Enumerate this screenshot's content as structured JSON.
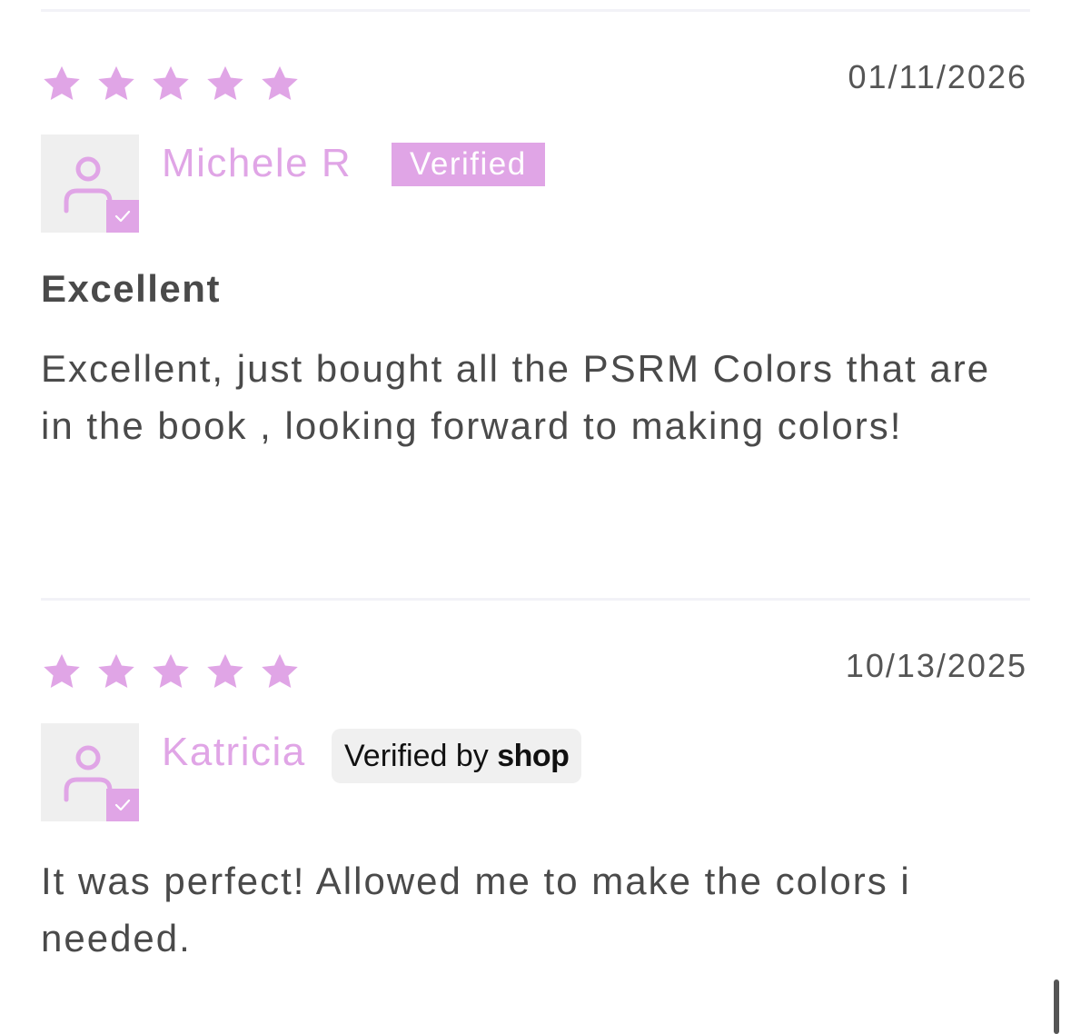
{
  "colors": {
    "accent": "#e0a5e6",
    "text": "#4a4a4a",
    "avatar_bg": "#efefef",
    "divider": "#f2f2f7"
  },
  "reviews": [
    {
      "rating": 5,
      "date": "01/11/2026",
      "name": "Michele R",
      "badge": "Verified",
      "title": "Excellent",
      "body": "Excellent, just bought all the PSRM Colors that are in the book , looking forward to making colors!"
    },
    {
      "rating": 5,
      "date": "10/13/2025",
      "name": "Katricia",
      "badge_prefix": "Verified by",
      "badge_brand": "shop",
      "body": "It was perfect! Allowed me to make the colors i needed."
    }
  ]
}
